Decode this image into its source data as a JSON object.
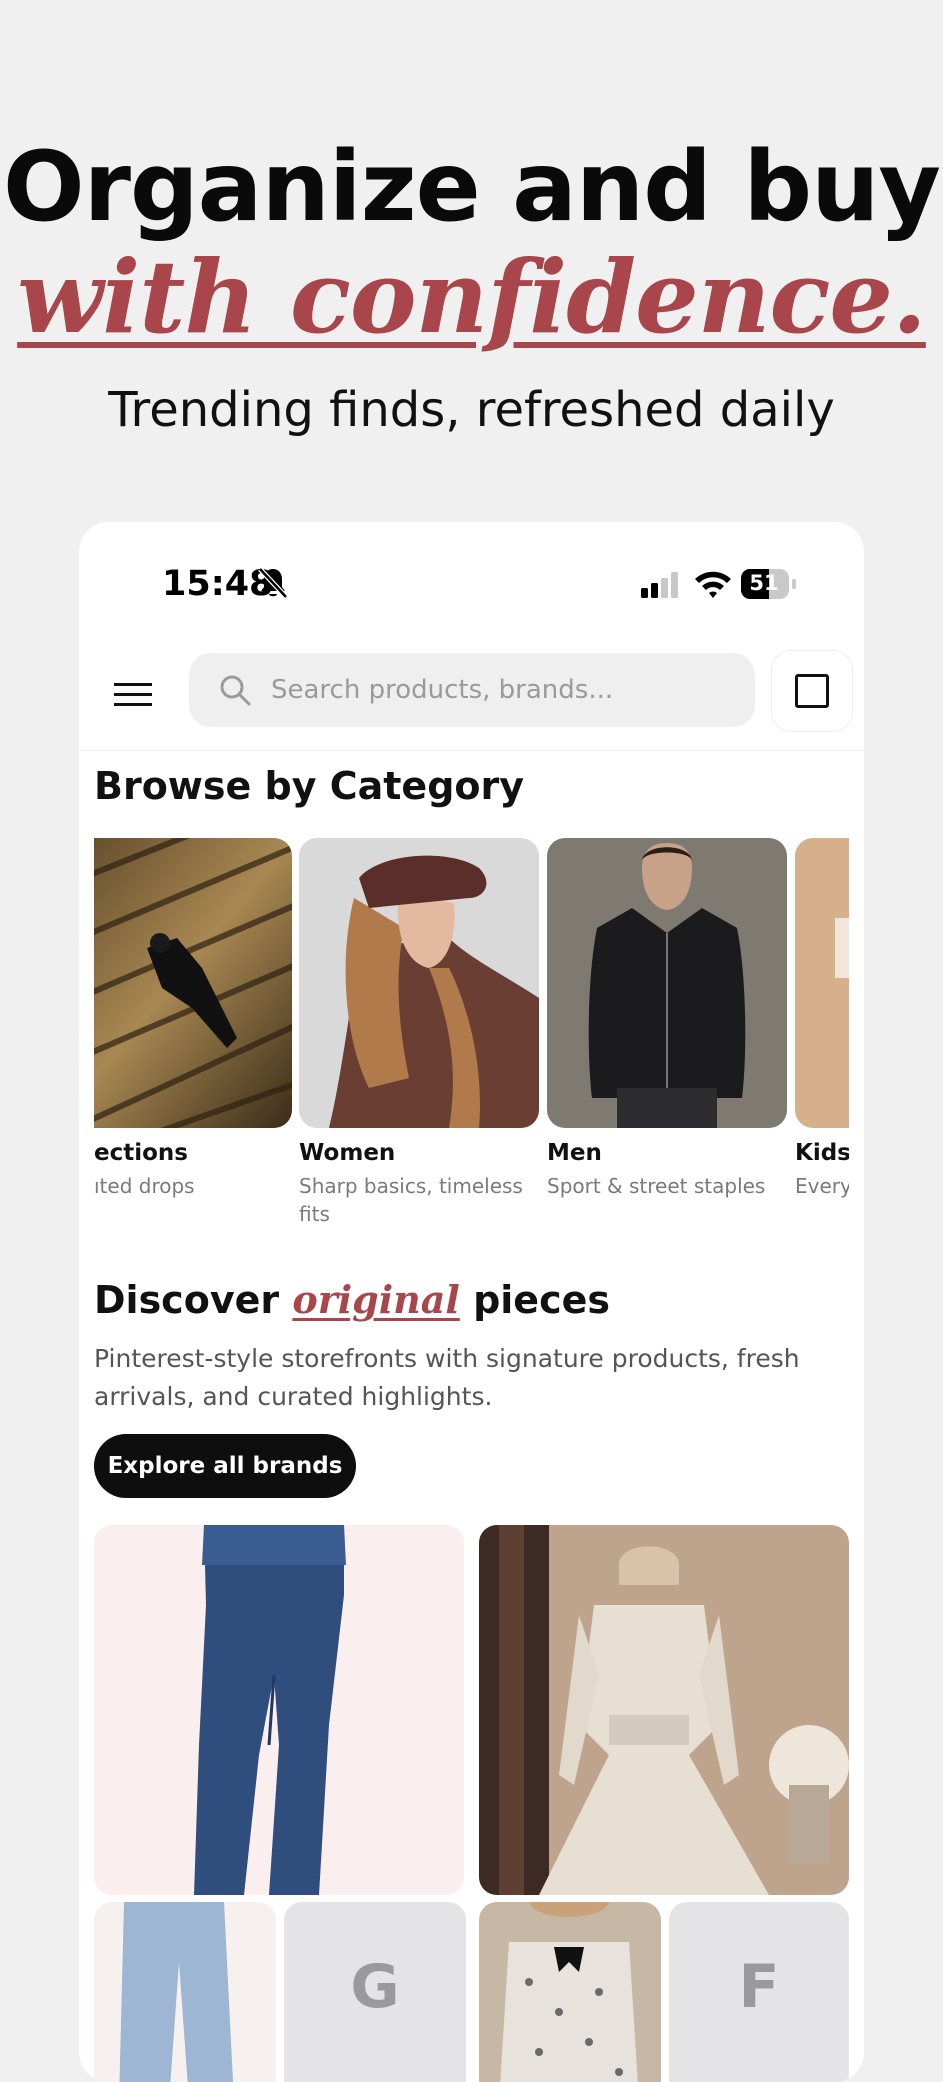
{
  "hero": {
    "title": "Organize and buy",
    "accent": "with confidence.",
    "subtitle": "Trending finds, refreshed daily"
  },
  "status": {
    "time": "15:48",
    "battery": "51"
  },
  "topbar": {
    "search_placeholder": "Search products, brands..."
  },
  "categories": {
    "title": "Browse by Category",
    "items": [
      {
        "name": "ections",
        "desc": "ıted drops"
      },
      {
        "name": "Women",
        "desc": "Sharp basics, timeless fits"
      },
      {
        "name": "Men",
        "desc": "Sport & street staples"
      },
      {
        "name": "Kids",
        "desc": "Every"
      }
    ]
  },
  "discover": {
    "title_start": "Discover ",
    "title_accent": "original",
    "title_end": " pieces",
    "description": "Pinterest-style storefronts with signature products, fresh arrivals, and curated highlights.",
    "button": "Explore all brands"
  },
  "brand_tiles": [
    {
      "letter": "G"
    },
    {
      "letter": "F"
    }
  ],
  "colors": {
    "accent": "#a9464b",
    "background": "#f0f0f0",
    "button": "#0e0e0e"
  }
}
